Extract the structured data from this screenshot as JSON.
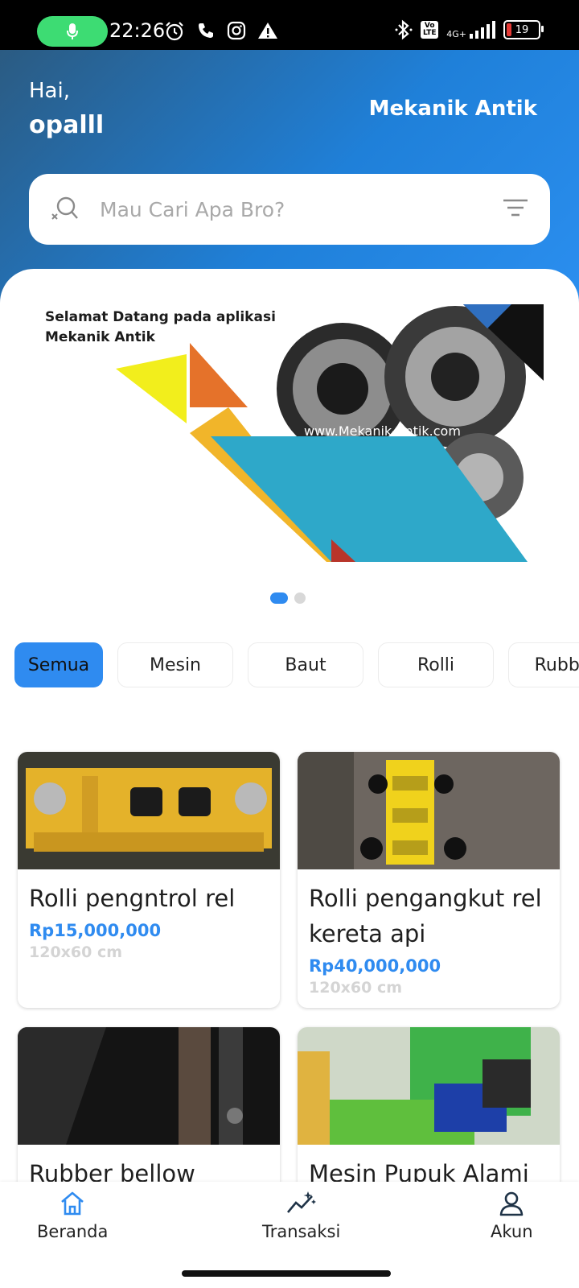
{
  "statusbar": {
    "time": "22:26",
    "network": "4G+",
    "volte": "Vo LTE",
    "battery": "19"
  },
  "header": {
    "greeting": "Hai,",
    "username": "opalll",
    "brand": "Mekanik Antik"
  },
  "search": {
    "placeholder": "Mau Cari Apa Bro?"
  },
  "banner": {
    "text": "Selamat Datang pada aplikasi Mekanik Antik",
    "url": "www.Mekanik-Antik.com",
    "pages": 2,
    "active_page": 1
  },
  "categories": [
    {
      "label": "Semua",
      "active": true
    },
    {
      "label": "Mesin",
      "active": false
    },
    {
      "label": "Baut",
      "active": false
    },
    {
      "label": "Rolli",
      "active": false
    },
    {
      "label": "Rubber",
      "active": false
    }
  ],
  "products": [
    {
      "title": "Rolli pengntrol rel",
      "price": "Rp15,000,000",
      "size": "120x60 cm"
    },
    {
      "title": "Rolli pengangkut rel kereta api",
      "price": "Rp40,000,000",
      "size": "120x60 cm"
    },
    {
      "title": "Rubber bellow",
      "price": "",
      "size": ""
    },
    {
      "title": "Mesin Pupuk Alami",
      "price": "",
      "size": ""
    }
  ],
  "nav": [
    {
      "label": "Beranda",
      "icon": "home-icon",
      "active": true
    },
    {
      "label": "Transaksi",
      "icon": "transaction-icon",
      "active": false
    },
    {
      "label": "Akun",
      "icon": "user-icon",
      "active": false
    }
  ],
  "colors": {
    "accent": "#2f8bf0",
    "header_start": "#2b5b82",
    "header_end": "#2b8ff0"
  }
}
